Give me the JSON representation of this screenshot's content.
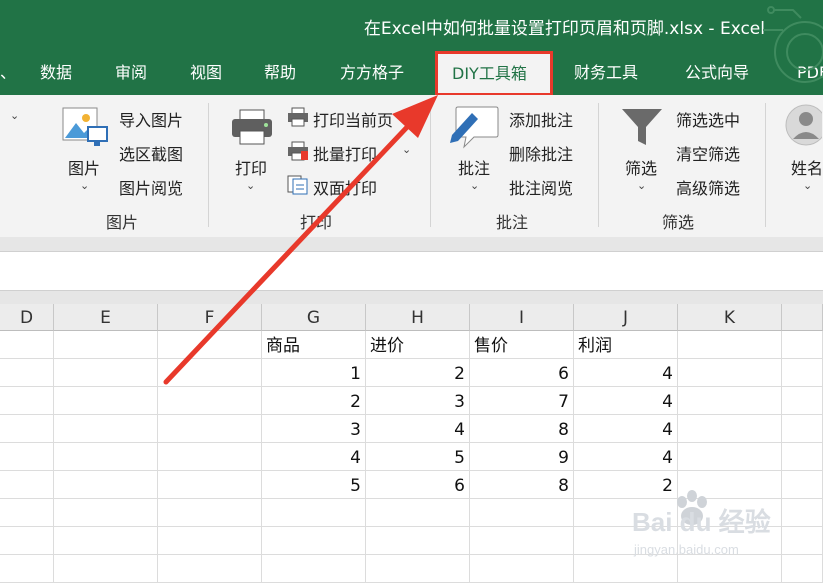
{
  "window": {
    "title": "在Excel中如何批量设置打印页眉和页脚.xlsx  -  Excel"
  },
  "tabs": [
    "数据",
    "审阅",
    "视图",
    "帮助",
    "方方格子",
    "DIY工具箱",
    "财务工具",
    "公式向导",
    "PDF"
  ],
  "active_tab": "DIY工具箱",
  "ribbon": {
    "group_picture": {
      "label": "图片",
      "big_button": "图片",
      "items": [
        "导入图片",
        "选区截图",
        "图片阅览"
      ]
    },
    "group_print": {
      "label": "打印",
      "big_button": "打印",
      "items": [
        "打印当前页",
        "批量打印",
        "双面打印"
      ]
    },
    "group_comment": {
      "label": "批注",
      "big_button": "批注",
      "items": [
        "添加批注",
        "删除批注",
        "批注阅览"
      ]
    },
    "group_filter": {
      "label": "筛选",
      "big_button": "筛选",
      "items": [
        "筛选选中",
        "清空筛选",
        "高级筛选"
      ]
    },
    "group_name": {
      "big_button": "姓名"
    }
  },
  "sheet": {
    "columns": [
      "D",
      "E",
      "F",
      "G",
      "H",
      "I",
      "J",
      "K"
    ],
    "headers": [
      "商品",
      "进价",
      "售价",
      "利润"
    ],
    "rows": [
      [
        "1",
        "2",
        "6",
        "4"
      ],
      [
        "2",
        "3",
        "7",
        "4"
      ],
      [
        "3",
        "4",
        "8",
        "4"
      ],
      [
        "4",
        "5",
        "9",
        "4"
      ],
      [
        "5",
        "6",
        "8",
        "2"
      ]
    ]
  },
  "annotation": {
    "color": "#e8392b"
  },
  "watermark": {
    "brand": "Bai du 经验",
    "url": "jingyan.baidu.com"
  },
  "colors": {
    "excel_green": "#217346",
    "highlight_red": "#e8392b"
  }
}
